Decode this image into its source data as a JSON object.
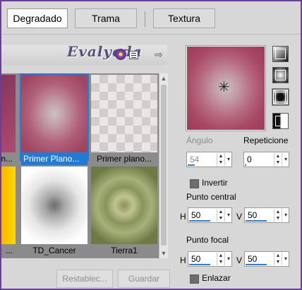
{
  "tabs": [
    {
      "label": "Degradado",
      "active": true
    },
    {
      "label": "Trama",
      "active": false
    },
    {
      "label": "Textura",
      "active": false
    }
  ],
  "palette_header": {
    "logo_text": "Evalyeda"
  },
  "gradients": [
    {
      "label": "n...",
      "selected": false
    },
    {
      "label": "Primer Plano...",
      "selected": true
    },
    {
      "label": "Primer plano...",
      "selected": false
    },
    {
      "label": "...",
      "selected": false
    },
    {
      "label": "TD_Cancer",
      "selected": false
    },
    {
      "label": "Tierra1",
      "selected": false
    }
  ],
  "buttons": {
    "reset": "Restablec...",
    "save": "Guardar"
  },
  "settings": {
    "angle_label": "Ángulo",
    "angle_value": "54",
    "repeat_label": "Repeticione",
    "repeat_value": "0",
    "invert_label": "Invertir",
    "center_label": "Punto central",
    "center_h": "50",
    "center_v": "50",
    "focal_label": "Punto focal",
    "focal_h": "50",
    "focal_v": "50",
    "link_label": "Enlazar",
    "h_letter": "H",
    "v_letter": "V"
  },
  "style_buttons": [
    "linear-gradient-icon",
    "rectangular-gradient-icon",
    "radial-gradient-icon",
    "sunburst-gradient-icon"
  ]
}
